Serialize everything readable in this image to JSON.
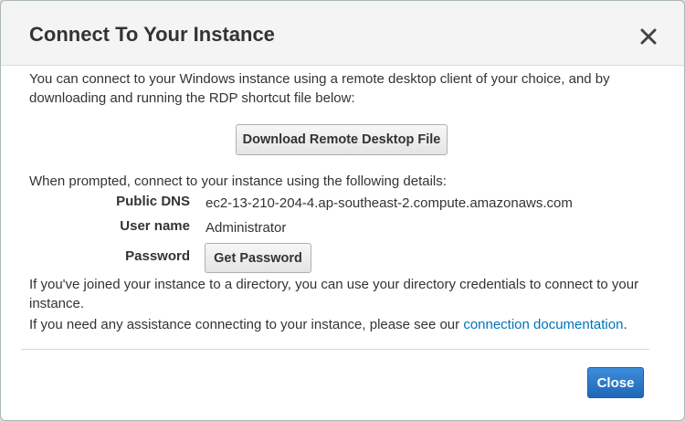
{
  "modal": {
    "title": "Connect To Your Instance",
    "close_icon": "close-icon",
    "intro_text": "You can connect to your Windows instance using a remote desktop client of your choice, and by downloading and running the RDP shortcut file below:",
    "download_button_label": "Download Remote Desktop File",
    "prompt_text": "When prompted, connect to your instance using the following details:",
    "details": {
      "public_dns_label": "Public DNS",
      "public_dns_value": "ec2-13-210-204-4.ap-southeast-2.compute.amazonaws.com",
      "username_label": "User name",
      "username_value": "Administrator",
      "password_label": "Password",
      "get_password_label": "Get Password"
    },
    "directory_text": "If you've joined your instance to a directory, you can use your directory credentials to connect to your instance.",
    "assistance_text": "If you need any assistance connecting to your instance, please see our ",
    "assistance_link": "connection documentation",
    "assistance_end": ".",
    "close_button_label": "Close"
  },
  "colors": {
    "primary_button": "#2a7ac9",
    "link": "#0073bb",
    "header_bg": "#f4f4f4"
  }
}
